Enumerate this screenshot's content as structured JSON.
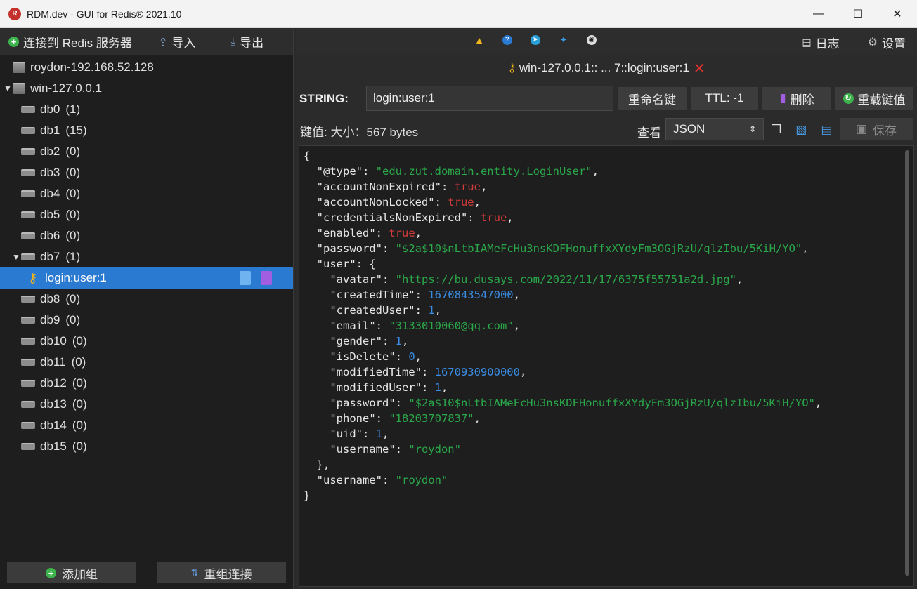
{
  "window": {
    "title": "RDM.dev - GUI for Redis® 2021.10",
    "controls": [
      "—",
      "☐",
      "✕"
    ]
  },
  "sidebar": {
    "toolbar": {
      "connect": "连接到 Redis 服务器",
      "import": "导入",
      "export": "导出"
    },
    "tree": [
      {
        "label": "roydon-192.168.52.128",
        "kind": "server",
        "depth": 0
      },
      {
        "label": "win-127.0.0.1",
        "kind": "server",
        "depth": 0,
        "expanded": true
      },
      {
        "label": "db0",
        "count": "(1)",
        "kind": "db",
        "depth": 1
      },
      {
        "label": "db1",
        "count": "(15)",
        "kind": "db",
        "depth": 1
      },
      {
        "label": "db2",
        "count": "(0)",
        "kind": "db",
        "depth": 1
      },
      {
        "label": "db3",
        "count": "(0)",
        "kind": "db",
        "depth": 1
      },
      {
        "label": "db4",
        "count": "(0)",
        "kind": "db",
        "depth": 1
      },
      {
        "label": "db5",
        "count": "(0)",
        "kind": "db",
        "depth": 1
      },
      {
        "label": "db6",
        "count": "(0)",
        "kind": "db",
        "depth": 1
      },
      {
        "label": "db7",
        "count": "(1)",
        "kind": "db",
        "depth": 1,
        "expanded": true
      },
      {
        "label": "login:user:1",
        "kind": "key",
        "depth": 2,
        "selected": true
      },
      {
        "label": "db8",
        "count": "(0)",
        "kind": "db",
        "depth": 1
      },
      {
        "label": "db9",
        "count": "(0)",
        "kind": "db",
        "depth": 1
      },
      {
        "label": "db10",
        "count": "(0)",
        "kind": "db",
        "depth": 1
      },
      {
        "label": "db11",
        "count": "(0)",
        "kind": "db",
        "depth": 1
      },
      {
        "label": "db12",
        "count": "(0)",
        "kind": "db",
        "depth": 1
      },
      {
        "label": "db13",
        "count": "(0)",
        "kind": "db",
        "depth": 1
      },
      {
        "label": "db14",
        "count": "(0)",
        "kind": "db",
        "depth": 1
      },
      {
        "label": "db15",
        "count": "(0)",
        "kind": "db",
        "depth": 1
      }
    ],
    "footer": {
      "add_group": "添加组",
      "regroup": "重组连接"
    }
  },
  "toolbar": {
    "icons": [
      "warning-icon",
      "help-icon",
      "telegram-icon",
      "twitter-icon",
      "github-icon"
    ],
    "log": "日志",
    "settings": "设置"
  },
  "tab": {
    "label": "win-127.0.0.1:: ... 7::login:user:1",
    "close": "✕"
  },
  "key": {
    "type": "STRING:",
    "name": "login:user:1",
    "rename": "重命名键",
    "ttl": "TTL:  -1",
    "delete": "删除",
    "reload": "重载键值"
  },
  "value": {
    "label": "键值: 大小：567 bytes",
    "view_label": "查看",
    "view_mode": "JSON",
    "save": "保存"
  },
  "colors": {
    "accent": "#2a7ad2",
    "string": "#2aa84a",
    "number": "#3a8ce3",
    "bool": "#d03a3a"
  },
  "json_lines": [
    [
      {
        "t": "{",
        "c": "k"
      }
    ],
    [
      {
        "t": "  \"@type\": ",
        "c": "k"
      },
      {
        "t": "\"edu.zut.domain.entity.LoginUser\"",
        "c": "s"
      },
      {
        "t": ",",
        "c": "k"
      }
    ],
    [
      {
        "t": "  \"accountNonExpired\": ",
        "c": "k"
      },
      {
        "t": "true",
        "c": "b"
      },
      {
        "t": ",",
        "c": "k"
      }
    ],
    [
      {
        "t": "  \"accountNonLocked\": ",
        "c": "k"
      },
      {
        "t": "true",
        "c": "b"
      },
      {
        "t": ",",
        "c": "k"
      }
    ],
    [
      {
        "t": "  \"credentialsNonExpired\": ",
        "c": "k"
      },
      {
        "t": "true",
        "c": "b"
      },
      {
        "t": ",",
        "c": "k"
      }
    ],
    [
      {
        "t": "  \"enabled\": ",
        "c": "k"
      },
      {
        "t": "true",
        "c": "b"
      },
      {
        "t": ",",
        "c": "k"
      }
    ],
    [
      {
        "t": "  \"password\": ",
        "c": "k"
      },
      {
        "t": "\"$2a$10$nLtbIAMeFcHu3nsKDFHonuffxXYdyFm3OGjRzU/qlzIbu/5KiH/YO\"",
        "c": "s"
      },
      {
        "t": ",",
        "c": "k"
      }
    ],
    [
      {
        "t": "  \"user\": {",
        "c": "k"
      }
    ],
    [
      {
        "t": "    \"avatar\": ",
        "c": "k"
      },
      {
        "t": "\"https://bu.dusays.com/2022/11/17/6375f55751a2d.jpg\"",
        "c": "s"
      },
      {
        "t": ",",
        "c": "k"
      }
    ],
    [
      {
        "t": "    \"createdTime\": ",
        "c": "k"
      },
      {
        "t": "1670843547000",
        "c": "n"
      },
      {
        "t": ",",
        "c": "k"
      }
    ],
    [
      {
        "t": "    \"createdUser\": ",
        "c": "k"
      },
      {
        "t": "1",
        "c": "n"
      },
      {
        "t": ",",
        "c": "k"
      }
    ],
    [
      {
        "t": "    \"email\": ",
        "c": "k"
      },
      {
        "t": "\"3133010060@qq.com\"",
        "c": "s"
      },
      {
        "t": ",",
        "c": "k"
      }
    ],
    [
      {
        "t": "    \"gender\": ",
        "c": "k"
      },
      {
        "t": "1",
        "c": "n"
      },
      {
        "t": ",",
        "c": "k"
      }
    ],
    [
      {
        "t": "    \"isDelete\": ",
        "c": "k"
      },
      {
        "t": "0",
        "c": "n"
      },
      {
        "t": ",",
        "c": "k"
      }
    ],
    [
      {
        "t": "    \"modifiedTime\": ",
        "c": "k"
      },
      {
        "t": "1670930900000",
        "c": "n"
      },
      {
        "t": ",",
        "c": "k"
      }
    ],
    [
      {
        "t": "    \"modifiedUser\": ",
        "c": "k"
      },
      {
        "t": "1",
        "c": "n"
      },
      {
        "t": ",",
        "c": "k"
      }
    ],
    [
      {
        "t": "    \"password\": ",
        "c": "k"
      },
      {
        "t": "\"$2a$10$nLtbIAMeFcHu3nsKDFHonuffxXYdyFm3OGjRzU/qlzIbu/5KiH/YO\"",
        "c": "s"
      },
      {
        "t": ",",
        "c": "k"
      }
    ],
    [
      {
        "t": "    \"phone\": ",
        "c": "k"
      },
      {
        "t": "\"18203707837\"",
        "c": "s"
      },
      {
        "t": ",",
        "c": "k"
      }
    ],
    [
      {
        "t": "    \"uid\": ",
        "c": "k"
      },
      {
        "t": "1",
        "c": "n"
      },
      {
        "t": ",",
        "c": "k"
      }
    ],
    [
      {
        "t": "    \"username\": ",
        "c": "k"
      },
      {
        "t": "\"roydon\"",
        "c": "s"
      }
    ],
    [
      {
        "t": "  },",
        "c": "k"
      }
    ],
    [
      {
        "t": "  \"username\": ",
        "c": "k"
      },
      {
        "t": "\"roydon\"",
        "c": "s"
      }
    ],
    [
      {
        "t": "}",
        "c": "k"
      }
    ]
  ]
}
